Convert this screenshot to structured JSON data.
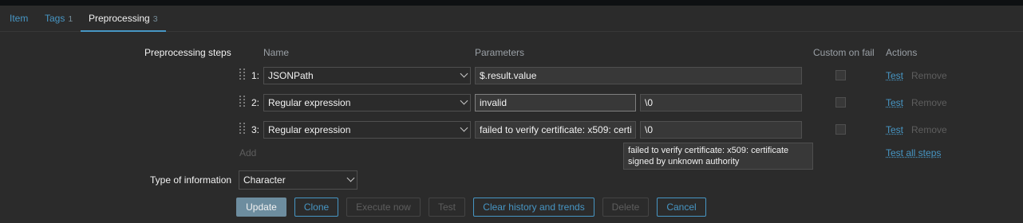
{
  "tabs": [
    {
      "label": "Item",
      "count": ""
    },
    {
      "label": "Tags",
      "count": "1"
    },
    {
      "label": "Preprocessing",
      "count": "3"
    }
  ],
  "form": {
    "steps_label": "Preprocessing steps",
    "headers": {
      "name": "Name",
      "parameters": "Parameters",
      "custom_on_fail": "Custom on fail",
      "actions": "Actions"
    },
    "steps": [
      {
        "number": "1:",
        "name": "JSONPath",
        "param1": "$.result.value",
        "param2": "",
        "test": "Test",
        "remove": "Remove"
      },
      {
        "number": "2:",
        "name": "Regular expression",
        "param1": "invalid",
        "param2": "\\0",
        "test": "Test",
        "remove": "Remove"
      },
      {
        "number": "3:",
        "name": "Regular expression",
        "param1": "failed to verify certificate: x509: certi",
        "param2": "\\0",
        "test": "Test",
        "remove": "Remove"
      }
    ],
    "add_label": "Add",
    "test_all_label": "Test all steps",
    "tooltip_line1": "failed to verify certificate: x509: certificate",
    "tooltip_line2": "signed by unknown authority",
    "type_label": "Type of information",
    "type_value": "Character"
  },
  "buttons": {
    "update": "Update",
    "clone": "Clone",
    "execute_now": "Execute now",
    "test": "Test",
    "clear_history": "Clear history and trends",
    "delete": "Delete",
    "cancel": "Cancel"
  },
  "colors": {
    "background": "#2b2b2b",
    "link": "#4796c4",
    "primary_button": "#6d8d9f"
  }
}
